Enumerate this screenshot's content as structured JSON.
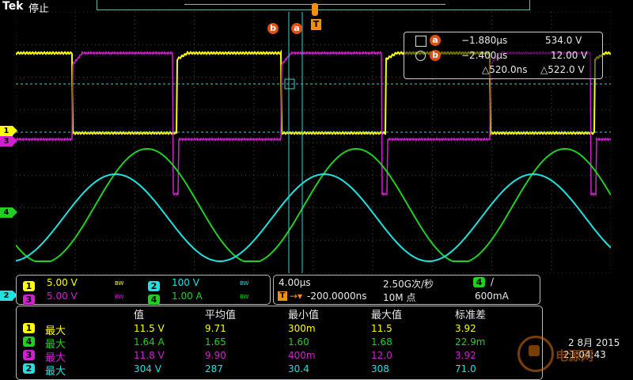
{
  "brand": "Tek",
  "status": "停止",
  "top_markers": {
    "b": "b",
    "a": "a",
    "t": "T"
  },
  "cursor": {
    "a": {
      "label": "a",
      "time": "−1.880µs",
      "value": "534.0 V"
    },
    "b": {
      "label": "b",
      "time": "−2.400µs",
      "value": "12.00 V"
    },
    "delta_time": "△520.0ns",
    "delta_value": "△522.0 V"
  },
  "channels": [
    {
      "num": "1",
      "scale": "5.00 V",
      "bw": "BW",
      "color": "#ffff00"
    },
    {
      "num": "3",
      "scale": "5.00 V",
      "bw": "BW",
      "color": "#d020d0"
    },
    {
      "num": "2",
      "scale": "100 V",
      "bw": "BW",
      "color": "#20e0e0"
    },
    {
      "num": "4",
      "scale": "1.00 A",
      "bw": "BW",
      "color": "#20d020"
    }
  ],
  "timebase": {
    "scale": "4.00µs",
    "rate": "2.50G次/秒",
    "trigger_pos": "-200.0000ns",
    "record": "10M 点",
    "trig_ch": "4",
    "trig_slope": "/",
    "trig_level": "600mA"
  },
  "measurements": {
    "headers": [
      "值",
      "平均值",
      "最小值",
      "最大值",
      "标准差"
    ],
    "rows": [
      {
        "ch": "1",
        "label": "最大",
        "color": "#ffff00",
        "values": [
          "11.5 V",
          "9.71",
          "300m",
          "11.5",
          "3.92"
        ]
      },
      {
        "ch": "4",
        "label": "最大",
        "color": "#20d020",
        "values": [
          "1.64 A",
          "1.65",
          "1.60",
          "1.68",
          "22.9m"
        ]
      },
      {
        "ch": "3",
        "label": "最大",
        "color": "#d020d0",
        "values": [
          "11.8 V",
          "9.90",
          "400m",
          "12.0",
          "3.92"
        ]
      },
      {
        "ch": "2",
        "label": "最大",
        "color": "#20e0e0",
        "values": [
          "304 V",
          "287",
          "30.4",
          "308",
          "71.0"
        ]
      }
    ]
  },
  "clock": {
    "date": "2 8月 2015",
    "time": "21:04:43"
  },
  "watermark": "电源网",
  "left_markers": [
    "1",
    "3",
    "4",
    "2"
  ]
}
